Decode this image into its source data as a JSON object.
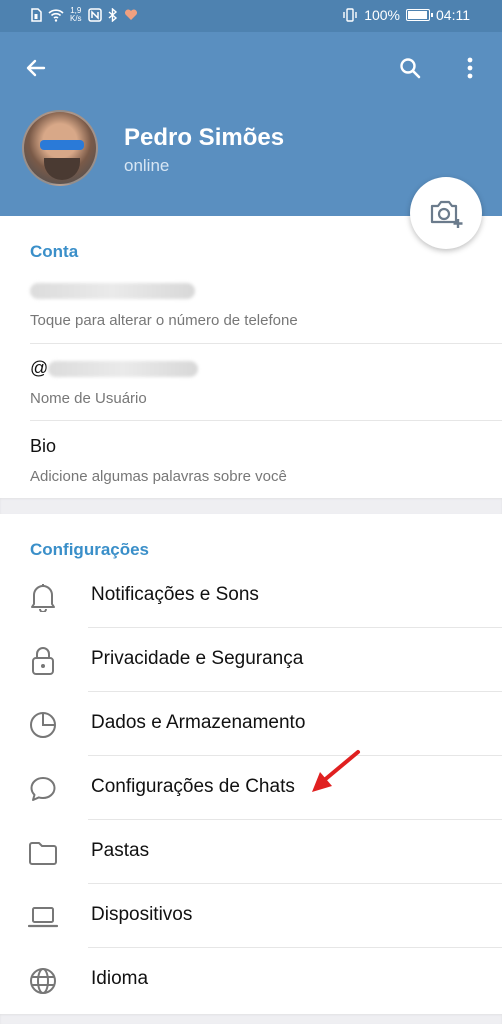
{
  "status_bar": {
    "network_speed": "1,9",
    "network_unit": "K/s",
    "battery_percent": "100%",
    "time": "04:11",
    "battery_level": 1.0
  },
  "header": {
    "user_name": "Pedro Simões",
    "user_status": "online"
  },
  "account": {
    "title": "Conta",
    "phone_hint": "Toque para alterar o número de telefone",
    "username_prefix": "@",
    "username_hint": "Nome de Usuário",
    "bio_label": "Bio",
    "bio_hint": "Adicione algumas palavras sobre você"
  },
  "settings": {
    "title": "Configurações",
    "items": [
      {
        "label": "Notificações e Sons",
        "icon": "bell-icon"
      },
      {
        "label": "Privacidade e Segurança",
        "icon": "lock-icon"
      },
      {
        "label": "Dados e Armazenamento",
        "icon": "clock-icon"
      },
      {
        "label": "Configurações de Chats",
        "icon": "chat-bubble-icon"
      },
      {
        "label": "Pastas",
        "icon": "folder-icon"
      },
      {
        "label": "Dispositivos",
        "icon": "laptop-icon"
      },
      {
        "label": "Idioma",
        "icon": "globe-icon"
      }
    ]
  },
  "colors": {
    "header_bg": "#5a8fc0",
    "status_bar_bg": "#4e82b0",
    "accent": "#3a8fc9",
    "annotation_arrow": "#e02020"
  }
}
